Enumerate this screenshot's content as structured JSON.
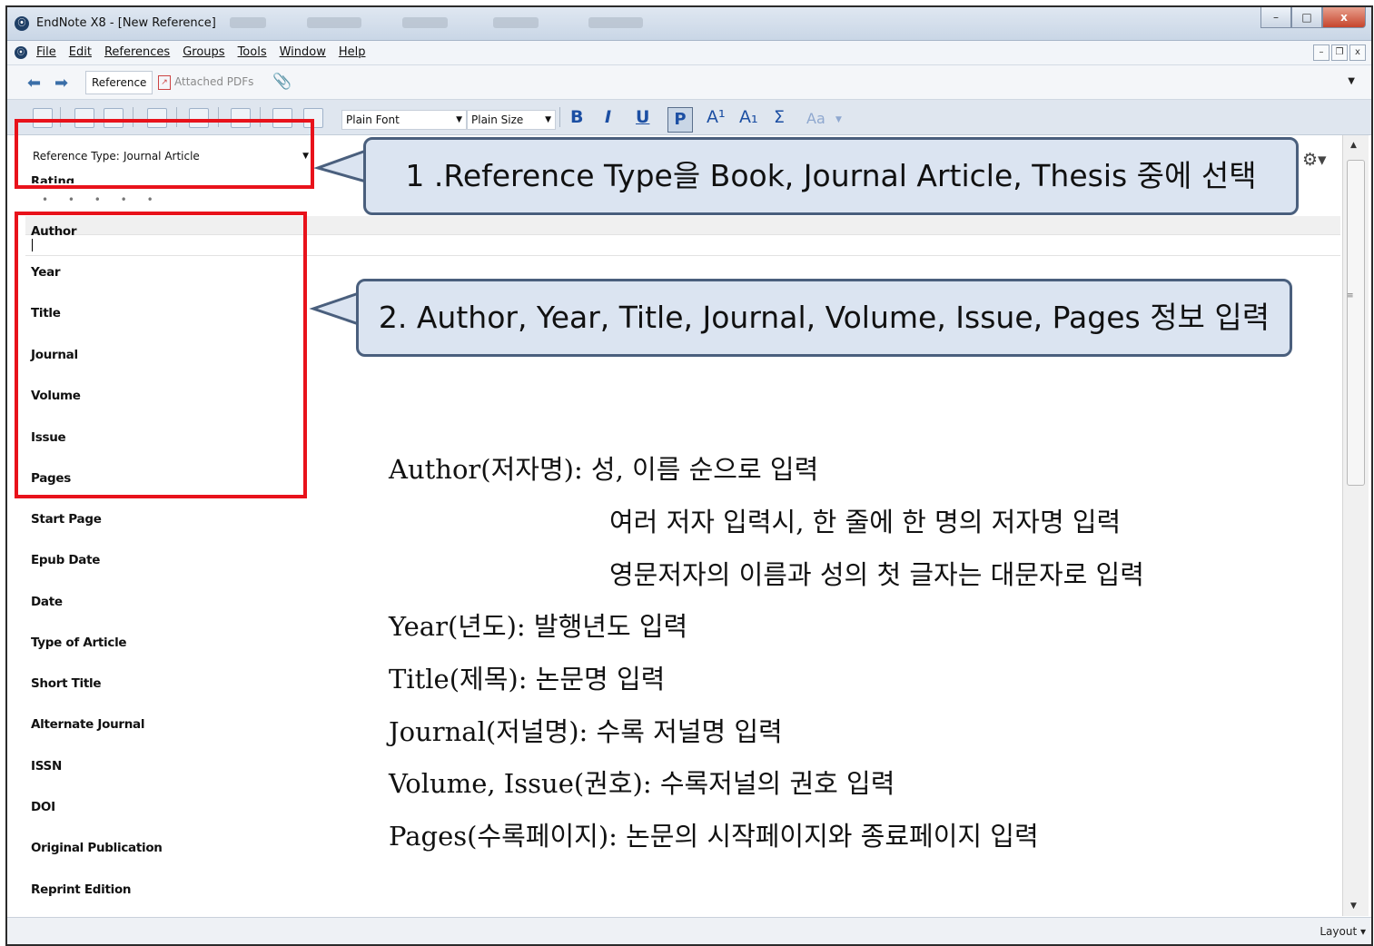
{
  "window": {
    "title": "EndNote X8 - [New Reference]",
    "app_icon_glyph": "⦿",
    "buttons": {
      "minimize": "–",
      "maximize": "□",
      "close": "x"
    }
  },
  "menubar": {
    "items": [
      "File",
      "Edit",
      "References",
      "Groups",
      "Tools",
      "Window",
      "Help"
    ],
    "mdi_buttons": {
      "minimize": "–",
      "restore": "❐",
      "close": "x"
    }
  },
  "tabs": {
    "reference": "Reference",
    "attached_pdfs": "Attached PDFs"
  },
  "toolbar": {
    "font": "Plain Font",
    "size": "Plain Size",
    "bold": "B",
    "italic": "I",
    "underline": "U",
    "plain": "P",
    "superscript": "A¹",
    "subscript": "A₁",
    "symbol": "Σ",
    "case": "Aa"
  },
  "reference": {
    "type_label": "Reference Type:",
    "type_value": "Journal Article",
    "rating_label": "Rating",
    "rating_dots": "• • • • •",
    "fields": [
      "Author",
      "Year",
      "Title",
      "Journal",
      "Volume",
      "Issue",
      "Pages",
      "Start Page",
      "Epub Date",
      "Date",
      "Type of Article",
      "Short Title",
      "Alternate Journal",
      "ISSN",
      "DOI",
      "Original Publication",
      "Reprint Edition"
    ]
  },
  "statusbar": {
    "layout": "Layout"
  },
  "callouts": {
    "step1": "1 .Reference Type을 Book, Journal Article, Thesis 중에 선택",
    "step2": "2. Author, Year, Title, Journal, Volume, Issue, Pages 정보 입력"
  },
  "notes": [
    "Author(저자명): 성, 이름 순으로 입력",
    "여러 저자 입력시, 한 줄에 한 명의 저자명 입력",
    "영문저자의 이름과 성의 첫 글자는 대문자로 입력",
    "Year(년도): 발행년도 입력",
    "Title(제목): 논문명 입력",
    "Journal(저널명): 수록 저널명 입력",
    "Volume, Issue(권호): 수록저널의 권호 입력",
    "Pages(수록페이지): 논문의 시작페이지와 종료페이지 입력"
  ],
  "colors": {
    "highlight": "#e8121b",
    "callout_fill": "#dbe4f1",
    "callout_border": "#4a5f7d",
    "toolbar_blue": "#1c4fa3"
  }
}
